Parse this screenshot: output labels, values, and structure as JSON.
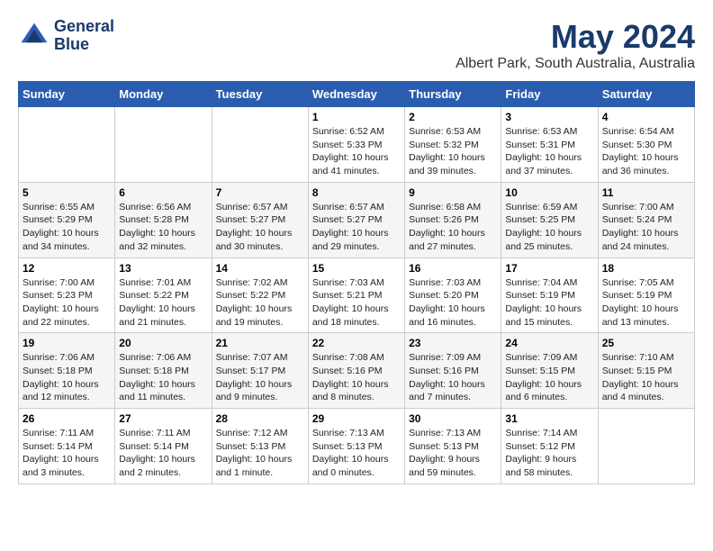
{
  "header": {
    "logo_line1": "General",
    "logo_line2": "Blue",
    "title": "May 2024",
    "subtitle": "Albert Park, South Australia, Australia"
  },
  "days_of_week": [
    "Sunday",
    "Monday",
    "Tuesday",
    "Wednesday",
    "Thursday",
    "Friday",
    "Saturday"
  ],
  "weeks": [
    [
      {
        "num": "",
        "info": ""
      },
      {
        "num": "",
        "info": ""
      },
      {
        "num": "",
        "info": ""
      },
      {
        "num": "1",
        "info": "Sunrise: 6:52 AM\nSunset: 5:33 PM\nDaylight: 10 hours\nand 41 minutes."
      },
      {
        "num": "2",
        "info": "Sunrise: 6:53 AM\nSunset: 5:32 PM\nDaylight: 10 hours\nand 39 minutes."
      },
      {
        "num": "3",
        "info": "Sunrise: 6:53 AM\nSunset: 5:31 PM\nDaylight: 10 hours\nand 37 minutes."
      },
      {
        "num": "4",
        "info": "Sunrise: 6:54 AM\nSunset: 5:30 PM\nDaylight: 10 hours\nand 36 minutes."
      }
    ],
    [
      {
        "num": "5",
        "info": "Sunrise: 6:55 AM\nSunset: 5:29 PM\nDaylight: 10 hours\nand 34 minutes."
      },
      {
        "num": "6",
        "info": "Sunrise: 6:56 AM\nSunset: 5:28 PM\nDaylight: 10 hours\nand 32 minutes."
      },
      {
        "num": "7",
        "info": "Sunrise: 6:57 AM\nSunset: 5:27 PM\nDaylight: 10 hours\nand 30 minutes."
      },
      {
        "num": "8",
        "info": "Sunrise: 6:57 AM\nSunset: 5:27 PM\nDaylight: 10 hours\nand 29 minutes."
      },
      {
        "num": "9",
        "info": "Sunrise: 6:58 AM\nSunset: 5:26 PM\nDaylight: 10 hours\nand 27 minutes."
      },
      {
        "num": "10",
        "info": "Sunrise: 6:59 AM\nSunset: 5:25 PM\nDaylight: 10 hours\nand 25 minutes."
      },
      {
        "num": "11",
        "info": "Sunrise: 7:00 AM\nSunset: 5:24 PM\nDaylight: 10 hours\nand 24 minutes."
      }
    ],
    [
      {
        "num": "12",
        "info": "Sunrise: 7:00 AM\nSunset: 5:23 PM\nDaylight: 10 hours\nand 22 minutes."
      },
      {
        "num": "13",
        "info": "Sunrise: 7:01 AM\nSunset: 5:22 PM\nDaylight: 10 hours\nand 21 minutes."
      },
      {
        "num": "14",
        "info": "Sunrise: 7:02 AM\nSunset: 5:22 PM\nDaylight: 10 hours\nand 19 minutes."
      },
      {
        "num": "15",
        "info": "Sunrise: 7:03 AM\nSunset: 5:21 PM\nDaylight: 10 hours\nand 18 minutes."
      },
      {
        "num": "16",
        "info": "Sunrise: 7:03 AM\nSunset: 5:20 PM\nDaylight: 10 hours\nand 16 minutes."
      },
      {
        "num": "17",
        "info": "Sunrise: 7:04 AM\nSunset: 5:19 PM\nDaylight: 10 hours\nand 15 minutes."
      },
      {
        "num": "18",
        "info": "Sunrise: 7:05 AM\nSunset: 5:19 PM\nDaylight: 10 hours\nand 13 minutes."
      }
    ],
    [
      {
        "num": "19",
        "info": "Sunrise: 7:06 AM\nSunset: 5:18 PM\nDaylight: 10 hours\nand 12 minutes."
      },
      {
        "num": "20",
        "info": "Sunrise: 7:06 AM\nSunset: 5:18 PM\nDaylight: 10 hours\nand 11 minutes."
      },
      {
        "num": "21",
        "info": "Sunrise: 7:07 AM\nSunset: 5:17 PM\nDaylight: 10 hours\nand 9 minutes."
      },
      {
        "num": "22",
        "info": "Sunrise: 7:08 AM\nSunset: 5:16 PM\nDaylight: 10 hours\nand 8 minutes."
      },
      {
        "num": "23",
        "info": "Sunrise: 7:09 AM\nSunset: 5:16 PM\nDaylight: 10 hours\nand 7 minutes."
      },
      {
        "num": "24",
        "info": "Sunrise: 7:09 AM\nSunset: 5:15 PM\nDaylight: 10 hours\nand 6 minutes."
      },
      {
        "num": "25",
        "info": "Sunrise: 7:10 AM\nSunset: 5:15 PM\nDaylight: 10 hours\nand 4 minutes."
      }
    ],
    [
      {
        "num": "26",
        "info": "Sunrise: 7:11 AM\nSunset: 5:14 PM\nDaylight: 10 hours\nand 3 minutes."
      },
      {
        "num": "27",
        "info": "Sunrise: 7:11 AM\nSunset: 5:14 PM\nDaylight: 10 hours\nand 2 minutes."
      },
      {
        "num": "28",
        "info": "Sunrise: 7:12 AM\nSunset: 5:13 PM\nDaylight: 10 hours\nand 1 minute."
      },
      {
        "num": "29",
        "info": "Sunrise: 7:13 AM\nSunset: 5:13 PM\nDaylight: 10 hours\nand 0 minutes."
      },
      {
        "num": "30",
        "info": "Sunrise: 7:13 AM\nSunset: 5:13 PM\nDaylight: 9 hours\nand 59 minutes."
      },
      {
        "num": "31",
        "info": "Sunrise: 7:14 AM\nSunset: 5:12 PM\nDaylight: 9 hours\nand 58 minutes."
      },
      {
        "num": "",
        "info": ""
      }
    ]
  ]
}
